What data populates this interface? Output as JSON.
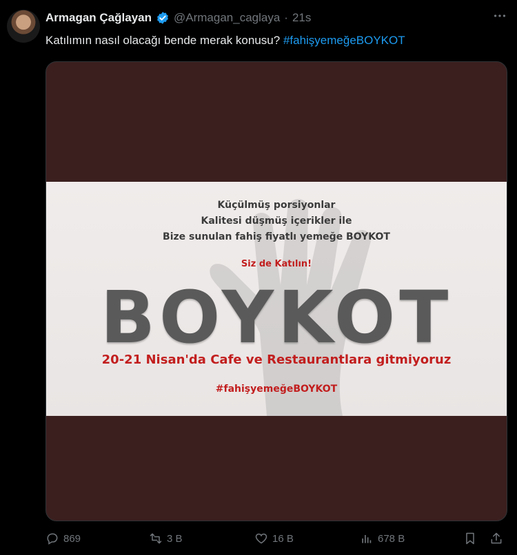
{
  "tweet": {
    "author_name": "Armagan Çağlayan",
    "handle": "@Armagan_caglaya",
    "separator": "·",
    "time": "21s",
    "text_prefix": "Katılımın nasıl olacağı bende merak konusu?",
    "hashtag": "#fahişyemeğeBOYKOT",
    "verified_color": "#1d9bf0",
    "more_icon": "more-icon"
  },
  "media": {
    "line1": "Küçülmüş porsiyonlar",
    "line2": "Kalitesi düşmüş içerikler ile",
    "line3": "Bize sunulan fahiş fiyatlı yemeğe BOYKOT",
    "line4": "Siz de Katılın!",
    "headline": "BOYKOT",
    "line5": "20-21 Nisan'da Cafe ve Restaurantlara gitmiyoruz",
    "line6": "#fahişyemeğeBOYKOT",
    "colors": {
      "background": "#3b1f1f",
      "band": "#f0eceb",
      "accent_red": "#c21e1e",
      "headline_gray": "#5a5a5a"
    }
  },
  "actions": {
    "replies": "869",
    "reposts": "3 B",
    "likes": "16 B",
    "views": "678 B"
  }
}
